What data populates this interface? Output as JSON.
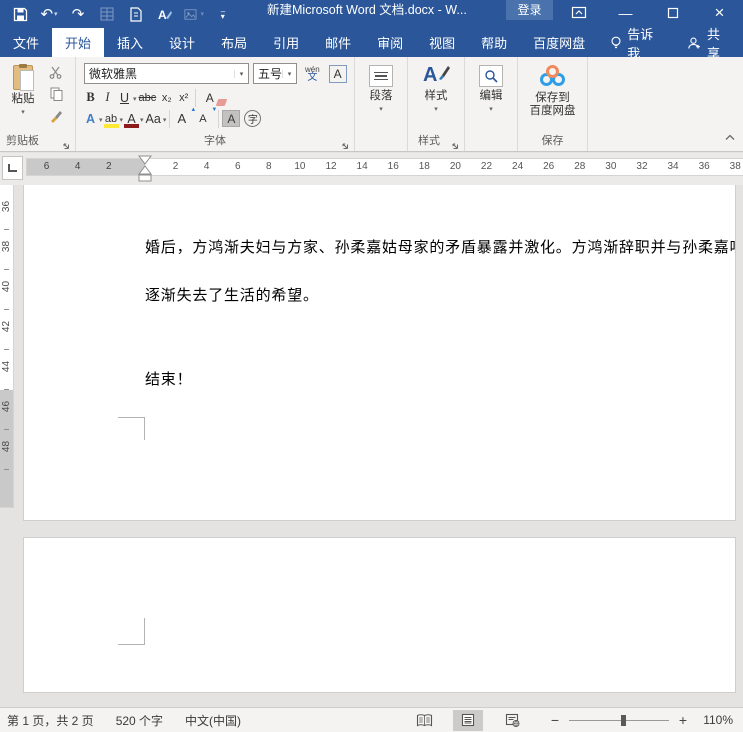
{
  "colors": {
    "titlebar_blue": "#2b579a",
    "login_bg": "#4a73ae",
    "highlight_yellow": "#ffe934",
    "font_color_red": "#8e1b1b",
    "baidu_blue": "#2e9fe6",
    "baidu_orange": "#f08a5d"
  },
  "window": {
    "title": "新建Microsoft Word 文档.docx - W...",
    "login": "登录"
  },
  "qat": [
    {
      "name": "save-icon",
      "glyph": "save",
      "disabled": false,
      "dropdown": false
    },
    {
      "name": "undo-icon",
      "glyph": "↶",
      "disabled": false,
      "dropdown": true
    },
    {
      "name": "redo-icon",
      "glyph": "↷",
      "disabled": false,
      "dropdown": false
    },
    {
      "name": "table-icon",
      "glyph": "table",
      "disabled": true,
      "dropdown": false
    },
    {
      "name": "new-page-icon",
      "glyph": "page",
      "disabled": false,
      "dropdown": false
    },
    {
      "name": "font-style-icon",
      "glyph": "A",
      "disabled": false,
      "dropdown": false
    },
    {
      "name": "picture-icon",
      "glyph": "image",
      "disabled": true,
      "dropdown": true
    },
    {
      "name": "customize-qat-icon",
      "glyph": "▾",
      "disabled": false,
      "dropdown": false
    }
  ],
  "tabs": [
    {
      "label": "文件",
      "class": "file"
    },
    {
      "label": "开始",
      "class": "active"
    },
    {
      "label": "插入"
    },
    {
      "label": "设计"
    },
    {
      "label": "布局"
    },
    {
      "label": "引用"
    },
    {
      "label": "邮件"
    },
    {
      "label": "审阅"
    },
    {
      "label": "视图"
    },
    {
      "label": "帮助"
    },
    {
      "label": "百度网盘"
    }
  ],
  "tab_extras": {
    "tellme": "告诉我",
    "share": "共享"
  },
  "ribbon": {
    "clipboard": {
      "paste": "粘贴",
      "group": "剪贴板"
    },
    "font": {
      "font_name": "微软雅黑",
      "font_size": "五号",
      "pinyin_top": "wén",
      "pinyin_bottom": "文",
      "char_border": "A",
      "bold": "B",
      "italic": "I",
      "underline": "U",
      "strike": "abc",
      "subscript": "x₂",
      "superscript": "x²",
      "clear_format": "A",
      "text_effects": "A",
      "highlight": "ab",
      "font_color": "A",
      "change_case": "Aa",
      "grow_font": "A",
      "shrink_font": "A",
      "shading": "A",
      "enclose": "字",
      "group": "字体"
    },
    "paragraph": {
      "label": "段落"
    },
    "styles": {
      "label": "样式",
      "group": "样式"
    },
    "editing": {
      "label": "编辑"
    },
    "save": {
      "line1": "保存到",
      "line2": "百度网盘",
      "group": "保存"
    }
  },
  "ruler": {
    "margin_numbers": [
      "6",
      "4",
      "2"
    ],
    "numbers": [
      "2",
      "4",
      "6",
      "8",
      "10",
      "12",
      "14",
      "16",
      "18",
      "20",
      "22",
      "24",
      "26",
      "28",
      "30",
      "32",
      "34",
      "36",
      "38"
    ],
    "v_numbers": [
      "36",
      "38",
      "40",
      "42",
      "44",
      "46",
      "48"
    ]
  },
  "document": {
    "line1": "婚后，方鸿渐夫妇与方家、孙柔嘉姑母家的矛盾暴露并激化。方鸿渐辞职并与孙柔嘉吵",
    "line2": "逐渐失去了生活的希望。",
    "line3": "结束！"
  },
  "statusbar": {
    "page_info": "第 1 页，共 2 页",
    "word_count": "520 个字",
    "language": "中文(中国)",
    "zoom": "110%"
  }
}
